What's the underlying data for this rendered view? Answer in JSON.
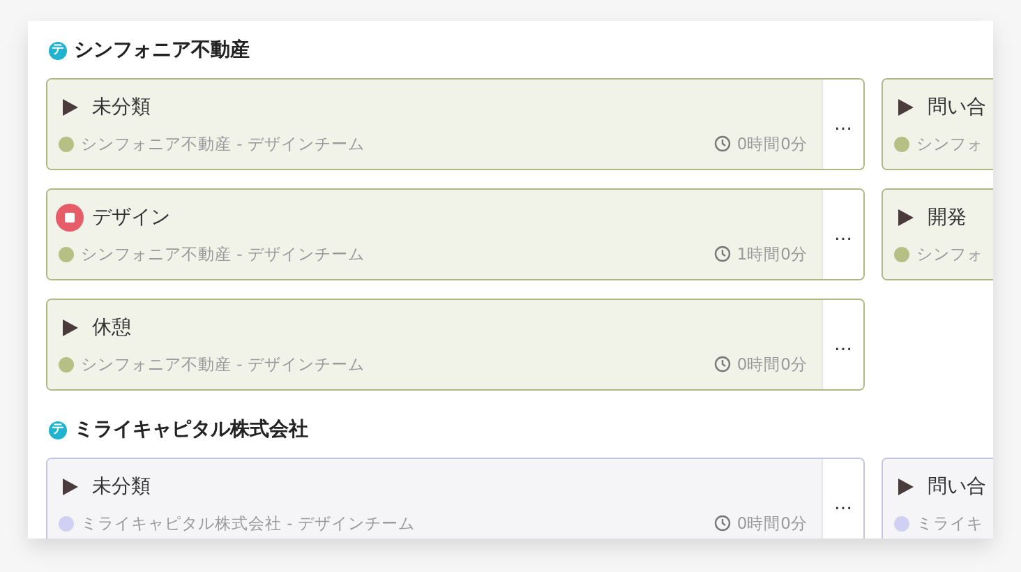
{
  "groups": [
    {
      "badge": "テ",
      "name": "シンフォニア不動産",
      "cards": [
        {
          "title": "未分類",
          "running": false,
          "color": "#b6c084",
          "subtitle": "シンフォニア不動産 - デザインチーム",
          "time": "0時間0分",
          "menu": "…"
        },
        {
          "title": "問い合",
          "running": false,
          "color": "#b6c084",
          "subtitle": "シンフォ"
        },
        {
          "title": "デザイン",
          "running": true,
          "color": "#b6c084",
          "subtitle": "シンフォニア不動産 - デザインチーム",
          "time": "1時間0分",
          "menu": "…"
        },
        {
          "title": "開発",
          "running": false,
          "color": "#b6c084",
          "subtitle": "シンフォ"
        },
        {
          "title": "休憩",
          "running": false,
          "color": "#b6c084",
          "subtitle": "シンフォニア不動産 - デザインチーム",
          "time": "0時間0分",
          "menu": "…"
        }
      ]
    },
    {
      "badge": "テ",
      "name": "ミライキャピタル株式会社",
      "cards": [
        {
          "title": "未分類",
          "running": false,
          "color": "#cfd0f2",
          "subtitle": "ミライキャピタル株式会社 - デザインチーム",
          "time": "0時間0分",
          "menu": "…"
        },
        {
          "title": "問い合",
          "running": false,
          "color": "#cfd0f2",
          "subtitle": "ミライキ"
        }
      ]
    }
  ]
}
